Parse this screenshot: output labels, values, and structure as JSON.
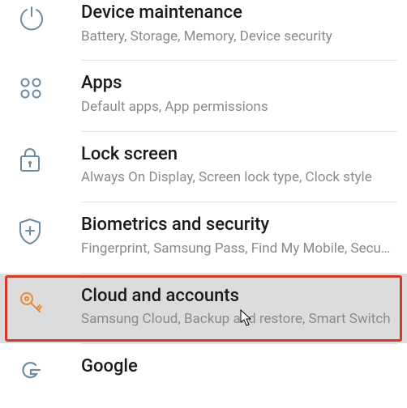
{
  "settings": {
    "items": [
      {
        "icon": "power-arc-icon",
        "title": "Device maintenance",
        "subtitle": "Battery, Storage, Memory, Device security"
      },
      {
        "icon": "apps-grid-icon",
        "title": "Apps",
        "subtitle": "Default apps, App permissions"
      },
      {
        "icon": "lock-icon",
        "title": "Lock screen",
        "subtitle": "Always On Display, Screen lock type, Clock style"
      },
      {
        "icon": "shield-plus-icon",
        "title": "Biometrics and security",
        "subtitle": "Fingerprint, Samsung Pass, Find My Mobile, Secure Folder"
      },
      {
        "icon": "key-icon",
        "title": "Cloud and accounts",
        "subtitle": "Samsung Cloud, Backup and restore, Smart Switch"
      },
      {
        "icon": "google-g-icon",
        "title": "Google",
        "subtitle": ""
      }
    ],
    "highlight_index": 4,
    "icon_color_default": "#6f8b9e",
    "icon_color_highlight": "#e88a3b",
    "highlight_border_color": "#d23a2a"
  }
}
